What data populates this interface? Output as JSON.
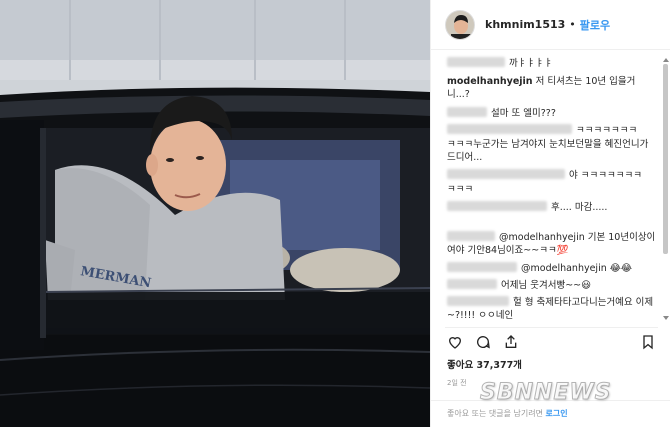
{
  "post": {
    "username": "khmnim1513",
    "separator": "•",
    "follow_label": "팔로우",
    "likes": "좋아요 37,377개",
    "time": "2일 전",
    "login_prompt": "좋아요 또는 댓글을 남기려면",
    "login_link": "로그인"
  },
  "comments": [
    {
      "user": "",
      "text": "까ㅑㅑㅑㅑ"
    },
    {
      "user": "modelhanhyejin",
      "text": "저 티셔츠는 10년 입을거니...?"
    },
    {
      "user": "",
      "text": "설마 또 엘미???"
    },
    {
      "user": "",
      "text": "ㅋㅋㅋㅋㅋㅋㅋ"
    },
    {
      "user": "",
      "text": "ㅋㅋㅋ누군가는 남겨야지 눈치보던말을 혜진언니가 드디어..."
    },
    {
      "user": "",
      "text": "야 ㅋㅋㅋㅋㅋㅋㅋ"
    },
    {
      "user": "",
      "text": "ㅋㅋㅋ"
    },
    {
      "user": "",
      "text": "후.... 마감....."
    },
    {
      "user": "",
      "text": "@modelhanhyejin 기본 10년이상이여야 기안84님이죠~~ㅋㅋ💯"
    },
    {
      "user": "",
      "text": "@modelhanhyejin 😂😂"
    },
    {
      "user": "",
      "text": "어제님 웃겨서빵~~😃"
    },
    {
      "user": "",
      "text": "헐 형 축제타타고다니는거예요 이제~?!!!! ㅇㅇ네인"
    }
  ],
  "colors": {
    "accent": "#3897f0",
    "text": "#262626",
    "muted": "#999999"
  },
  "icons": [
    "heart-icon",
    "comment-icon",
    "share-icon",
    "bookmark-icon"
  ],
  "watermark": "SBNNEWS"
}
